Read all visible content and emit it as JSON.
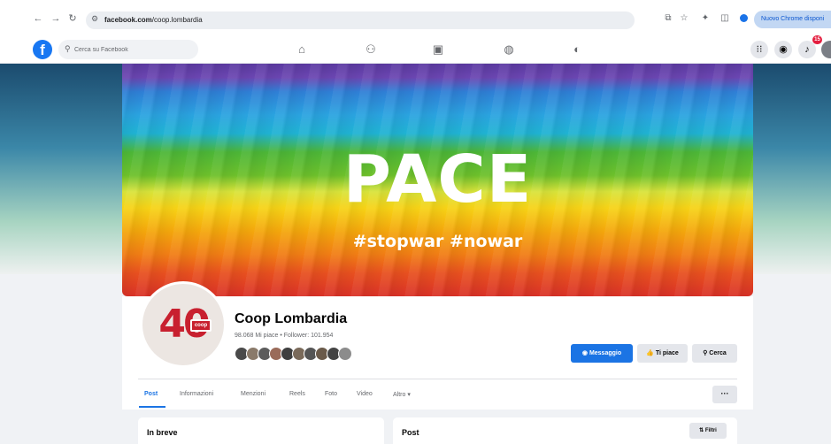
{
  "browser": {
    "url_host": "facebook.com",
    "url_path": "/coop.lombardia",
    "update_label": "Nuovo Chrome disponi"
  },
  "fb_nav": {
    "search_placeholder": "Cerca su Facebook",
    "logo": "f",
    "notification_count": "15"
  },
  "cover": {
    "title": "PACE",
    "hashtags": "#stopwar #nowar"
  },
  "profile": {
    "name": "Coop Lombardia",
    "stats": "98.068 Mi piace • Follower: 101.954",
    "logo_number": "40",
    "logo_badge": "coop"
  },
  "actions": {
    "message": "Messaggio",
    "like": "Ti piace",
    "search": "Cerca"
  },
  "tabs": [
    "Post",
    "Informazioni",
    "Menzioni",
    "Reels",
    "Foto",
    "Video",
    "Altro ▾"
  ],
  "more_label": "···",
  "cards": {
    "left_title": "In breve",
    "right_title": "Post",
    "filter_label": "Filtri"
  },
  "colors": {
    "fb_blue": "#1877f2",
    "button_blue": "#1b74e4",
    "coop_red": "#c8202f"
  }
}
